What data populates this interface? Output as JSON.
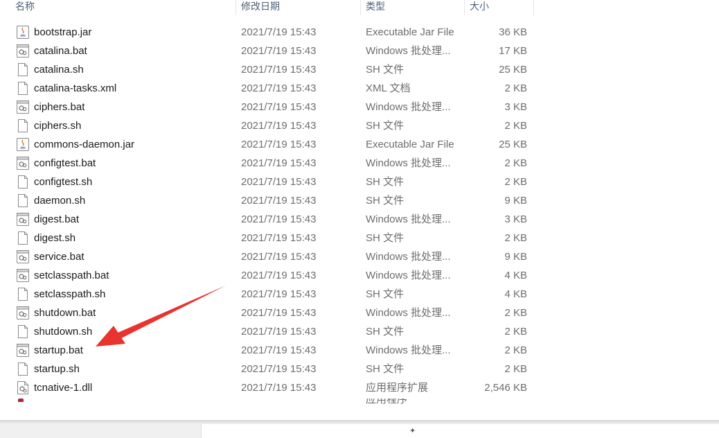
{
  "columns": {
    "name": "名称",
    "date": "修改日期",
    "type": "类型",
    "size": "大小"
  },
  "files": [
    {
      "name": "bootstrap.jar",
      "date": "2021/7/19 15:43",
      "type": "Executable Jar File",
      "size": "36 KB",
      "icon": "java-jar-icon"
    },
    {
      "name": "catalina.bat",
      "date": "2021/7/19 15:43",
      "type": "Windows 批处理...",
      "size": "17 KB",
      "icon": "batch-file-icon"
    },
    {
      "name": "catalina.sh",
      "date": "2021/7/19 15:43",
      "type": "SH 文件",
      "size": "25 KB",
      "icon": "blank-file-icon"
    },
    {
      "name": "catalina-tasks.xml",
      "date": "2021/7/19 15:43",
      "type": "XML 文档",
      "size": "2 KB",
      "icon": "blank-file-icon"
    },
    {
      "name": "ciphers.bat",
      "date": "2021/7/19 15:43",
      "type": "Windows 批处理...",
      "size": "3 KB",
      "icon": "batch-file-icon"
    },
    {
      "name": "ciphers.sh",
      "date": "2021/7/19 15:43",
      "type": "SH 文件",
      "size": "2 KB",
      "icon": "blank-file-icon"
    },
    {
      "name": "commons-daemon.jar",
      "date": "2021/7/19 15:43",
      "type": "Executable Jar File",
      "size": "25 KB",
      "icon": "java-jar-icon"
    },
    {
      "name": "configtest.bat",
      "date": "2021/7/19 15:43",
      "type": "Windows 批处理...",
      "size": "2 KB",
      "icon": "batch-file-icon"
    },
    {
      "name": "configtest.sh",
      "date": "2021/7/19 15:43",
      "type": "SH 文件",
      "size": "2 KB",
      "icon": "blank-file-icon"
    },
    {
      "name": "daemon.sh",
      "date": "2021/7/19 15:43",
      "type": "SH 文件",
      "size": "9 KB",
      "icon": "blank-file-icon"
    },
    {
      "name": "digest.bat",
      "date": "2021/7/19 15:43",
      "type": "Windows 批处理...",
      "size": "3 KB",
      "icon": "batch-file-icon"
    },
    {
      "name": "digest.sh",
      "date": "2021/7/19 15:43",
      "type": "SH 文件",
      "size": "2 KB",
      "icon": "blank-file-icon"
    },
    {
      "name": "service.bat",
      "date": "2021/7/19 15:43",
      "type": "Windows 批处理...",
      "size": "9 KB",
      "icon": "batch-file-icon"
    },
    {
      "name": "setclasspath.bat",
      "date": "2021/7/19 15:43",
      "type": "Windows 批处理...",
      "size": "4 KB",
      "icon": "batch-file-icon"
    },
    {
      "name": "setclasspath.sh",
      "date": "2021/7/19 15:43",
      "type": "SH 文件",
      "size": "4 KB",
      "icon": "blank-file-icon"
    },
    {
      "name": "shutdown.bat",
      "date": "2021/7/19 15:43",
      "type": "Windows 批处理...",
      "size": "2 KB",
      "icon": "batch-file-icon"
    },
    {
      "name": "shutdown.sh",
      "date": "2021/7/19 15:43",
      "type": "SH 文件",
      "size": "2 KB",
      "icon": "blank-file-icon"
    },
    {
      "name": "startup.bat",
      "date": "2021/7/19 15:43",
      "type": "Windows 批处理...",
      "size": "2 KB",
      "icon": "batch-file-icon"
    },
    {
      "name": "startup.sh",
      "date": "2021/7/19 15:43",
      "type": "SH 文件",
      "size": "2 KB",
      "icon": "blank-file-icon"
    },
    {
      "name": "tcnative-1.dll",
      "date": "2021/7/19 15:43",
      "type": "应用程序扩展",
      "size": "2,546 KB",
      "icon": "dll-file-icon"
    }
  ],
  "partial_row": {
    "type": "应用程序"
  },
  "annotation": {
    "arrow_color": "#e8332f",
    "points_to": "startup.bat"
  },
  "colors": {
    "header_text": "#4c607a",
    "secondary_text": "#6d6d6d"
  }
}
